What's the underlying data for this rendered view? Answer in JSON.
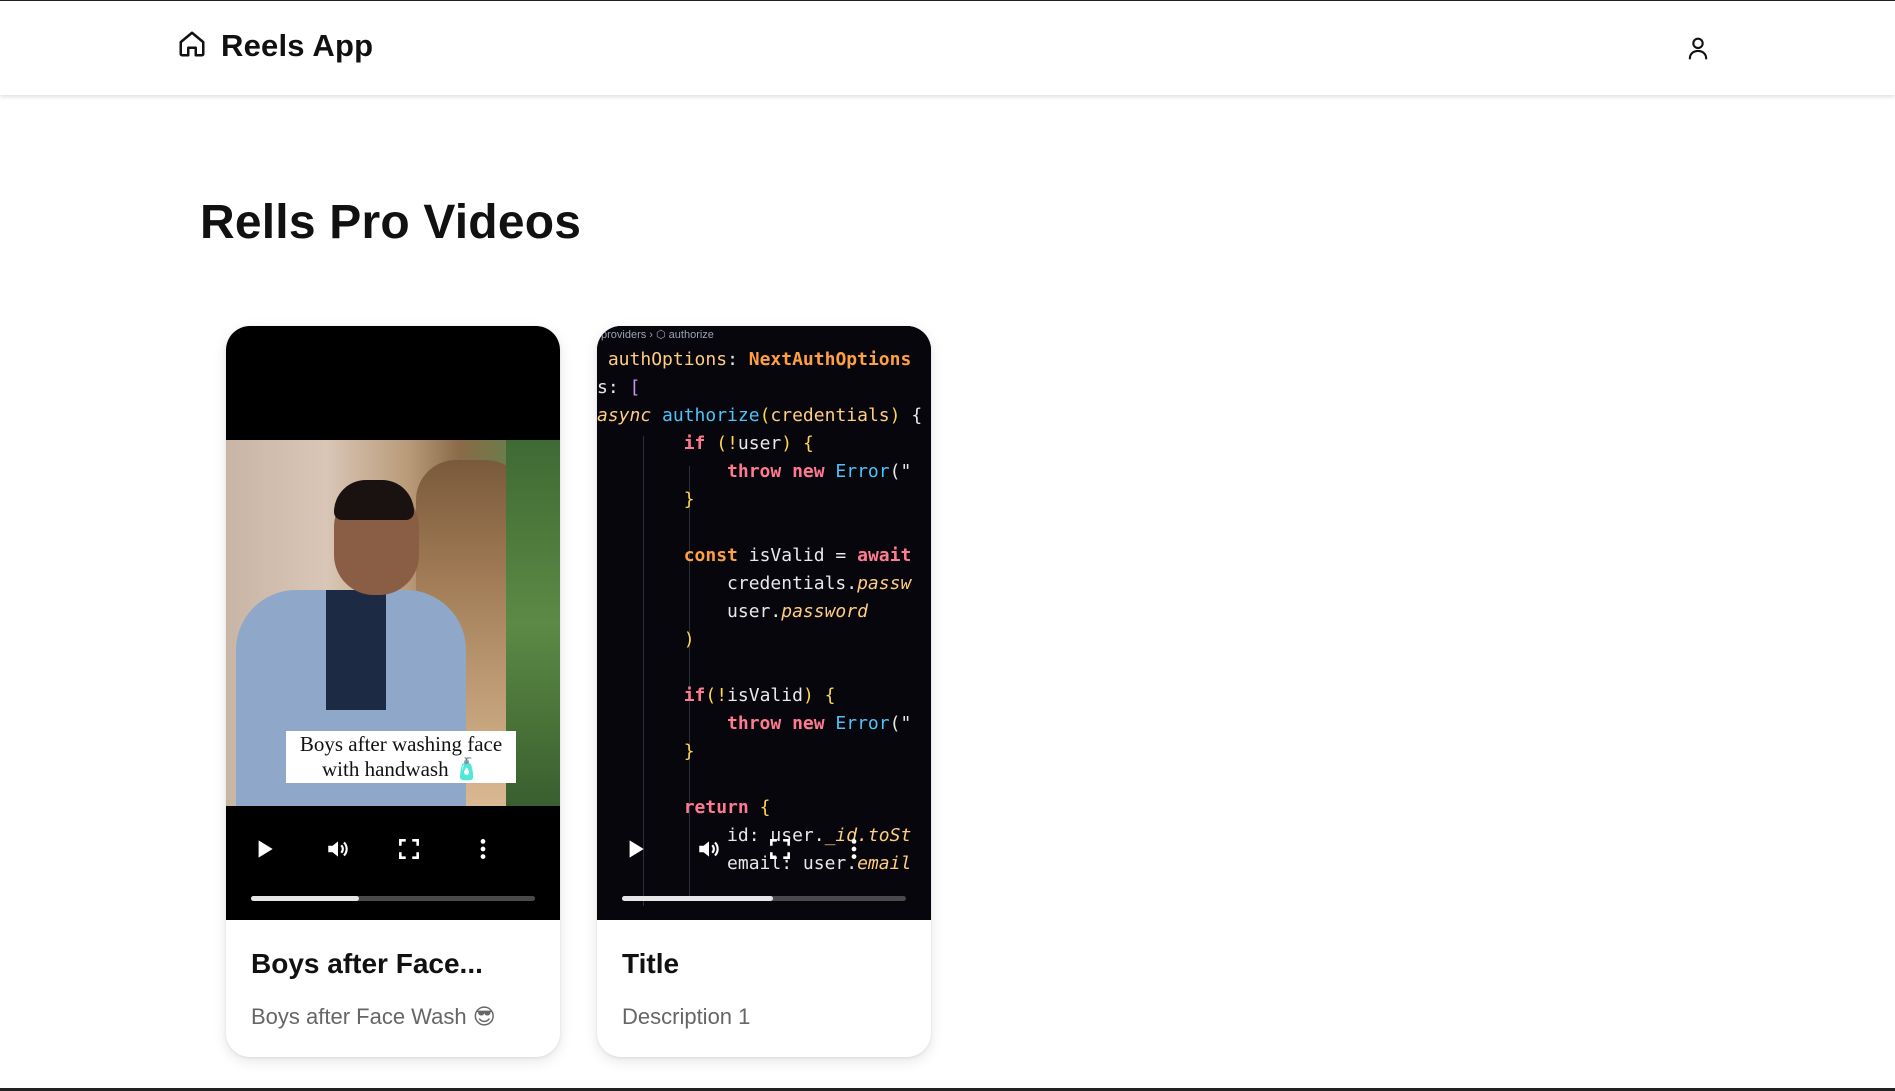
{
  "app": {
    "title": "Reels App"
  },
  "header": {
    "home_icon": "home-icon",
    "user_icon": "user-icon"
  },
  "page": {
    "heading": "Rells Pro Videos"
  },
  "videos": [
    {
      "title": "Boys after Face...",
      "description": "Boys after Face Wash 😎",
      "caption_line1": "Boys after washing face",
      "caption_line2": "with handwash 🧴",
      "progress": 0.38
    },
    {
      "title": "Title",
      "description": "Description 1",
      "breadcrumb": "providers › ⬡ authorize",
      "progress": 0.53
    }
  ],
  "code_lines": [
    {
      "parts": [
        [
          " ",
          "w"
        ],
        [
          "authOptions",
          "v"
        ],
        [
          ": ",
          "w"
        ],
        [
          "NextAuthOptions",
          "t"
        ]
      ]
    },
    {
      "parts": [
        [
          "s: ",
          "w"
        ],
        [
          "[",
          "pl"
        ]
      ]
    },
    {
      "parts": [
        [
          "async ",
          "i"
        ],
        [
          "authorize",
          "f"
        ],
        [
          "(",
          "p"
        ],
        [
          "credentials",
          "v"
        ],
        [
          ")",
          "p"
        ],
        [
          " {",
          "w"
        ]
      ]
    },
    {
      "parts": [
        [
          "        ",
          "w"
        ],
        [
          "if",
          "k"
        ],
        [
          " (!",
          "p"
        ],
        [
          "user",
          "w"
        ],
        [
          ") {",
          "p"
        ]
      ]
    },
    {
      "parts": [
        [
          "            ",
          "w"
        ],
        [
          "throw new ",
          "k"
        ],
        [
          "Error",
          "f"
        ],
        [
          "(\"",
          "w"
        ]
      ]
    },
    {
      "parts": [
        [
          "        ",
          "w"
        ],
        [
          "}",
          "p"
        ]
      ]
    },
    {
      "parts": [
        [
          "",
          "w"
        ]
      ]
    },
    {
      "parts": [
        [
          "        ",
          "w"
        ],
        [
          "const ",
          "t"
        ],
        [
          "isValid",
          "w"
        ],
        [
          " = ",
          "w"
        ],
        [
          "await",
          "k"
        ]
      ]
    },
    {
      "parts": [
        [
          "            ",
          "w"
        ],
        [
          "credentials.",
          "w"
        ],
        [
          "passw",
          "i"
        ]
      ]
    },
    {
      "parts": [
        [
          "            ",
          "w"
        ],
        [
          "user.",
          "w"
        ],
        [
          "password",
          "i"
        ]
      ]
    },
    {
      "parts": [
        [
          "        ",
          "w"
        ],
        [
          ")",
          "p"
        ]
      ]
    },
    {
      "parts": [
        [
          "",
          "w"
        ]
      ]
    },
    {
      "parts": [
        [
          "        ",
          "w"
        ],
        [
          "if",
          "k"
        ],
        [
          "(!",
          "p"
        ],
        [
          "isValid",
          "w"
        ],
        [
          ") {",
          "p"
        ]
      ]
    },
    {
      "parts": [
        [
          "            ",
          "w"
        ],
        [
          "throw new ",
          "k"
        ],
        [
          "Error",
          "f"
        ],
        [
          "(\"",
          "w"
        ]
      ]
    },
    {
      "parts": [
        [
          "        ",
          "w"
        ],
        [
          "}",
          "p"
        ]
      ]
    },
    {
      "parts": [
        [
          "",
          "w"
        ]
      ]
    },
    {
      "parts": [
        [
          "        ",
          "w"
        ],
        [
          "return",
          "k"
        ],
        [
          " {",
          "p"
        ]
      ]
    },
    {
      "parts": [
        [
          "            ",
          "w"
        ],
        [
          "id: ",
          "w"
        ],
        [
          "user.",
          "w"
        ],
        [
          "_id.toSt",
          "i"
        ]
      ]
    },
    {
      "parts": [
        [
          "            ",
          "w"
        ],
        [
          "email: ",
          "w"
        ],
        [
          "user.",
          "w"
        ],
        [
          "email",
          "i"
        ]
      ]
    }
  ]
}
